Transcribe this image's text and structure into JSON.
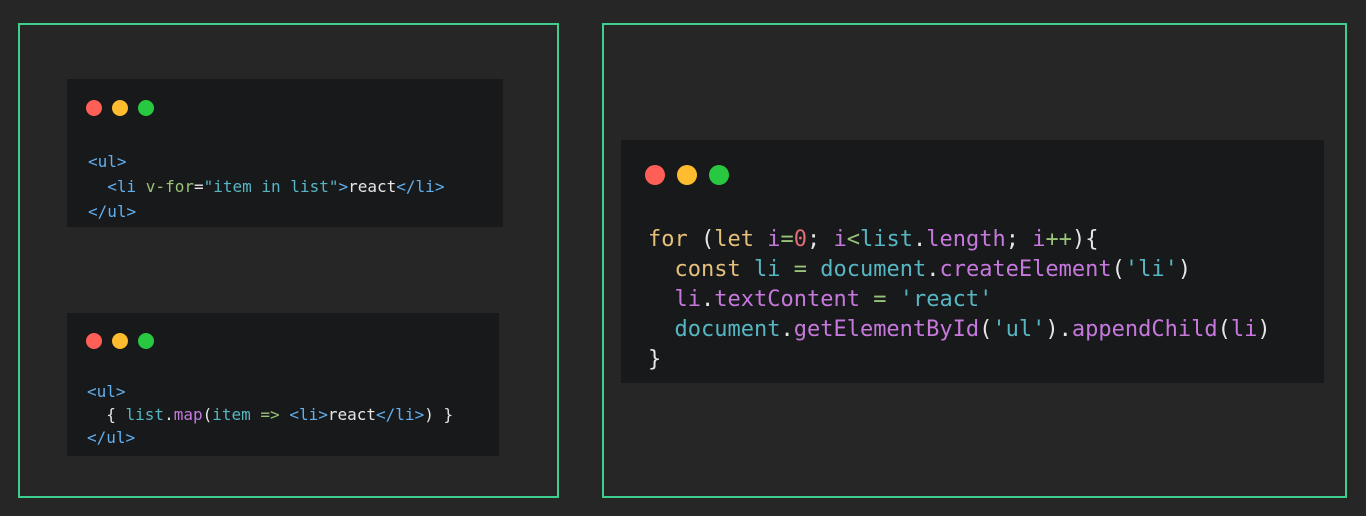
{
  "colors": {
    "background": "#262626",
    "panel_border": "#3ecf8e",
    "editor_bg": "#18191b",
    "dot_red": "#ff5f57",
    "dot_yellow": "#febc2e",
    "dot_green": "#28c840"
  },
  "window_controls": [
    "close-dot",
    "minimize-dot",
    "maximize-dot"
  ],
  "vue_snippet": {
    "tokens": [
      {
        "t": "<ul>",
        "c": "tag"
      },
      {
        "t": "\n  ",
        "c": "plain"
      },
      {
        "t": "<li ",
        "c": "tag"
      },
      {
        "t": "v-for",
        "c": "attr"
      },
      {
        "t": "=",
        "c": "plain"
      },
      {
        "t": "\"item in list\"",
        "c": "str"
      },
      {
        "t": ">",
        "c": "tag"
      },
      {
        "t": "react",
        "c": "plain"
      },
      {
        "t": "</li>",
        "c": "tag"
      },
      {
        "t": "\n",
        "c": "plain"
      },
      {
        "t": "</ul>",
        "c": "tag"
      }
    ]
  },
  "jsx_snippet": {
    "tokens": [
      {
        "t": "<ul>",
        "c": "tag"
      },
      {
        "t": "\n  { ",
        "c": "plain"
      },
      {
        "t": "list",
        "c": "obj"
      },
      {
        "t": ".",
        "c": "plain"
      },
      {
        "t": "map",
        "c": "fn"
      },
      {
        "t": "(",
        "c": "plain"
      },
      {
        "t": "item",
        "c": "obj"
      },
      {
        "t": " ",
        "c": "plain"
      },
      {
        "t": "=>",
        "c": "op"
      },
      {
        "t": " ",
        "c": "plain"
      },
      {
        "t": "<li>",
        "c": "tag"
      },
      {
        "t": "react",
        "c": "plain"
      },
      {
        "t": "</li>",
        "c": "tag"
      },
      {
        "t": ") }",
        "c": "plain"
      },
      {
        "t": "\n",
        "c": "plain"
      },
      {
        "t": "</ul>",
        "c": "tag"
      }
    ]
  },
  "dom_snippet": {
    "tokens": [
      {
        "t": "for",
        "c": "kw"
      },
      {
        "t": " (",
        "c": "plain"
      },
      {
        "t": "let",
        "c": "kw"
      },
      {
        "t": " ",
        "c": "plain"
      },
      {
        "t": "i",
        "c": "var"
      },
      {
        "t": "=",
        "c": "op"
      },
      {
        "t": "0",
        "c": "num"
      },
      {
        "t": "; ",
        "c": "plain"
      },
      {
        "t": "i",
        "c": "var"
      },
      {
        "t": "<",
        "c": "op"
      },
      {
        "t": "list",
        "c": "obj"
      },
      {
        "t": ".",
        "c": "plain"
      },
      {
        "t": "length",
        "c": "fn"
      },
      {
        "t": "; ",
        "c": "plain"
      },
      {
        "t": "i",
        "c": "var"
      },
      {
        "t": "++",
        "c": "op"
      },
      {
        "t": "){",
        "c": "plain"
      },
      {
        "t": "\n  ",
        "c": "plain"
      },
      {
        "t": "const",
        "c": "kw"
      },
      {
        "t": " ",
        "c": "plain"
      },
      {
        "t": "li",
        "c": "obj"
      },
      {
        "t": " ",
        "c": "plain"
      },
      {
        "t": "=",
        "c": "op"
      },
      {
        "t": " ",
        "c": "plain"
      },
      {
        "t": "document",
        "c": "obj"
      },
      {
        "t": ".",
        "c": "plain"
      },
      {
        "t": "createElement",
        "c": "fn"
      },
      {
        "t": "(",
        "c": "plain"
      },
      {
        "t": "'li'",
        "c": "str"
      },
      {
        "t": ")",
        "c": "plain"
      },
      {
        "t": "\n  ",
        "c": "plain"
      },
      {
        "t": "li",
        "c": "var"
      },
      {
        "t": ".",
        "c": "plain"
      },
      {
        "t": "textContent",
        "c": "fn"
      },
      {
        "t": " ",
        "c": "plain"
      },
      {
        "t": "=",
        "c": "op"
      },
      {
        "t": " ",
        "c": "plain"
      },
      {
        "t": "'react'",
        "c": "str"
      },
      {
        "t": "\n  ",
        "c": "plain"
      },
      {
        "t": "document",
        "c": "obj"
      },
      {
        "t": ".",
        "c": "plain"
      },
      {
        "t": "getElementById",
        "c": "fn"
      },
      {
        "t": "(",
        "c": "plain"
      },
      {
        "t": "'ul'",
        "c": "str"
      },
      {
        "t": ").",
        "c": "plain"
      },
      {
        "t": "appendChild",
        "c": "fn"
      },
      {
        "t": "(",
        "c": "plain"
      },
      {
        "t": "li",
        "c": "var"
      },
      {
        "t": ")",
        "c": "plain"
      },
      {
        "t": "\n",
        "c": "plain"
      },
      {
        "t": "}",
        "c": "plain"
      }
    ]
  }
}
